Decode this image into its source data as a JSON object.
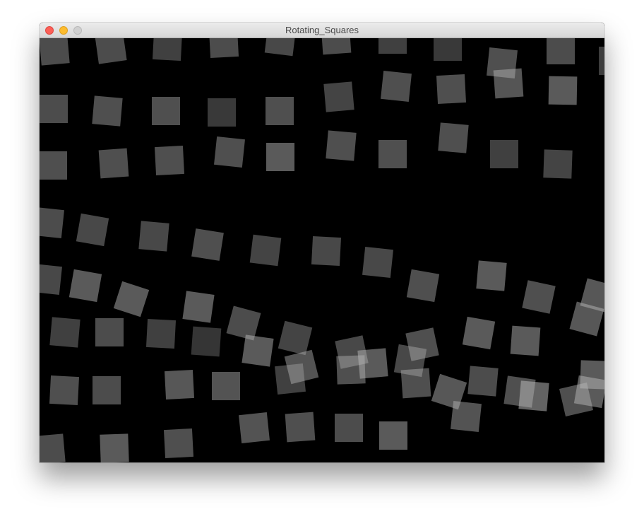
{
  "window": {
    "title": "Rotating_Squares",
    "controls": {
      "close_color": "#fc5f57",
      "minimize_color": "#fdbc2e",
      "zoom_color": "#d0d0d0"
    }
  },
  "canvas": {
    "background": "#000000",
    "square_fill": "#bdbdbd",
    "squares": [
      [
        21,
        17,
        -5,
        0.4
      ],
      [
        101,
        14,
        -8,
        0.4
      ],
      [
        181,
        11,
        3,
        0.34
      ],
      [
        261,
        7,
        -3,
        0.4
      ],
      [
        341,
        3,
        7,
        0.38
      ],
      [
        420,
        2,
        -4,
        0.4
      ],
      [
        500,
        2,
        0,
        0.34
      ],
      [
        578,
        12,
        0,
        0.3
      ],
      [
        655,
        35,
        6,
        0.42
      ],
      [
        738,
        17,
        0,
        0.4
      ],
      [
        812,
        32,
        0,
        0.32
      ],
      [
        20,
        100,
        0,
        0.4
      ],
      [
        96,
        103,
        5,
        0.42
      ],
      [
        179,
        103,
        0,
        0.42
      ],
      [
        258,
        105,
        0,
        0.3
      ],
      [
        340,
        103,
        0,
        0.42
      ],
      [
        424,
        83,
        -5,
        0.36
      ],
      [
        505,
        68,
        6,
        0.42
      ],
      [
        583,
        72,
        -3,
        0.42
      ],
      [
        664,
        64,
        -4,
        0.45
      ],
      [
        741,
        74,
        1,
        0.48
      ],
      [
        19,
        180,
        0,
        0.42
      ],
      [
        105,
        177,
        -4,
        0.42
      ],
      [
        184,
        173,
        -3,
        0.42
      ],
      [
        269,
        161,
        6,
        0.42
      ],
      [
        341,
        168,
        0,
        0.48
      ],
      [
        427,
        152,
        5,
        0.42
      ],
      [
        500,
        164,
        0,
        0.42
      ],
      [
        586,
        141,
        5,
        0.42
      ],
      [
        658,
        164,
        0,
        0.34
      ],
      [
        734,
        178,
        2,
        0.36
      ],
      [
        13,
        261,
        6,
        0.4
      ],
      [
        75,
        271,
        10,
        0.38
      ],
      [
        162,
        280,
        5,
        0.38
      ],
      [
        238,
        292,
        9,
        0.42
      ],
      [
        320,
        300,
        7,
        0.36
      ],
      [
        406,
        301,
        3,
        0.38
      ],
      [
        479,
        317,
        6,
        0.38
      ],
      [
        543,
        350,
        10,
        0.42
      ],
      [
        640,
        336,
        5,
        0.48
      ],
      [
        707,
        366,
        12,
        0.42
      ],
      [
        790,
        364,
        15,
        0.46
      ],
      [
        10,
        341,
        6,
        0.38
      ],
      [
        65,
        350,
        10,
        0.48
      ],
      [
        130,
        369,
        18,
        0.48
      ],
      [
        225,
        380,
        8,
        0.48
      ],
      [
        289,
        403,
        15,
        0.4
      ],
      [
        36,
        416,
        5,
        0.34
      ],
      [
        99,
        416,
        0,
        0.4
      ],
      [
        172,
        418,
        3,
        0.34
      ],
      [
        236,
        429,
        4,
        0.28
      ],
      [
        309,
        442,
        8,
        0.48
      ],
      [
        362,
        424,
        14,
        0.36
      ],
      [
        442,
        444,
        -12,
        0.38
      ],
      [
        542,
        433,
        -12,
        0.42
      ],
      [
        622,
        417,
        10,
        0.48
      ],
      [
        688,
        428,
        4,
        0.48
      ],
      [
        775,
        397,
        15,
        0.46
      ],
      [
        371,
        465,
        -14,
        0.44
      ],
      [
        355,
        482,
        -6,
        0.34
      ],
      [
        441,
        469,
        -2,
        0.42
      ],
      [
        472,
        460,
        -5,
        0.48
      ],
      [
        525,
        456,
        10,
        0.38
      ],
      [
        533,
        488,
        -4,
        0.42
      ],
      [
        580,
        500,
        18,
        0.46
      ],
      [
        628,
        485,
        5,
        0.4
      ],
      [
        680,
        500,
        8,
        0.42
      ],
      [
        700,
        506,
        5,
        0.52
      ],
      [
        760,
        511,
        -13,
        0.42
      ],
      [
        786,
        476,
        2,
        0.48
      ],
      [
        780,
        500,
        10,
        0.48
      ],
      [
        35,
        498,
        3,
        0.42
      ],
      [
        95,
        498,
        0,
        0.4
      ],
      [
        198,
        490,
        -3,
        0.46
      ],
      [
        264,
        492,
        0,
        0.44
      ],
      [
        304,
        551,
        -6,
        0.44
      ],
      [
        369,
        550,
        -4,
        0.42
      ],
      [
        438,
        551,
        0,
        0.4
      ],
      [
        501,
        562,
        0,
        0.48
      ],
      [
        604,
        535,
        6,
        0.44
      ],
      [
        15,
        581,
        -5,
        0.4
      ],
      [
        106,
        580,
        -2,
        0.48
      ],
      [
        197,
        573,
        -3,
        0.42
      ]
    ]
  }
}
